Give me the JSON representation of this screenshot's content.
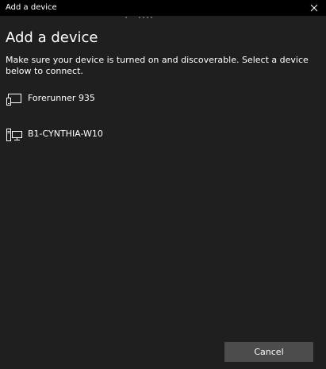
{
  "window": {
    "title": "Add a device"
  },
  "header": {
    "heading": "Add a device",
    "instructions": "Make sure your device is turned on and discoverable. Select a device below to connect."
  },
  "devices": [
    {
      "name": "Forerunner 935",
      "icon": "display-device-icon"
    },
    {
      "name": "B1-CYNTHIA-W10",
      "icon": "computer-icon"
    }
  ],
  "footer": {
    "cancel_label": "Cancel"
  },
  "colors": {
    "background": "#1f1f1f",
    "titlebar": "#000000",
    "button": "#4c4c4c",
    "text": "#ffffff"
  }
}
